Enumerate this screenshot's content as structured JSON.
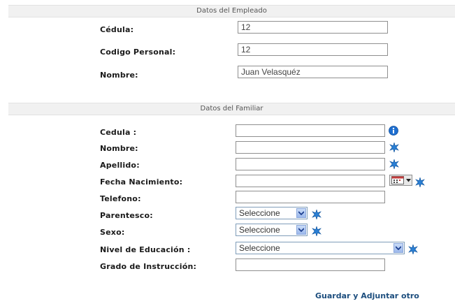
{
  "empleado": {
    "header": "Datos del Empleado",
    "cedula_label": "Cédula:",
    "cedula_value": "12",
    "codigo_label": "Codigo Personal:",
    "codigo_value": "12",
    "nombre_label": "Nombre:",
    "nombre_value": "Juan Velasquéz"
  },
  "familiar": {
    "header": "Datos del Familiar",
    "cedula_label": "Cedula :",
    "nombre_label": "Nombre:",
    "apellido_label": "Apellido:",
    "fecha_label": "Fecha Nacimiento:",
    "telefono_label": "Telefono:",
    "parentesco_label": "Parentesco:",
    "parentesco_value": "Seleccione",
    "sexo_label": "Sexo:",
    "sexo_value": "Seleccione",
    "educacion_label": "Nivel de Educación :",
    "educacion_value": "Seleccione",
    "grado_label": "Grado de Instrucción:"
  },
  "actions": {
    "save_label": "Guardar y Adjuntar otro"
  },
  "icons": {
    "required": "required-star-icon",
    "info": "info-icon",
    "calendar": "calendar-icon"
  },
  "colors": {
    "accent_link": "#1d4e7e",
    "info_blue": "#1e6fd0",
    "star_blue": "#2a7fd4"
  }
}
